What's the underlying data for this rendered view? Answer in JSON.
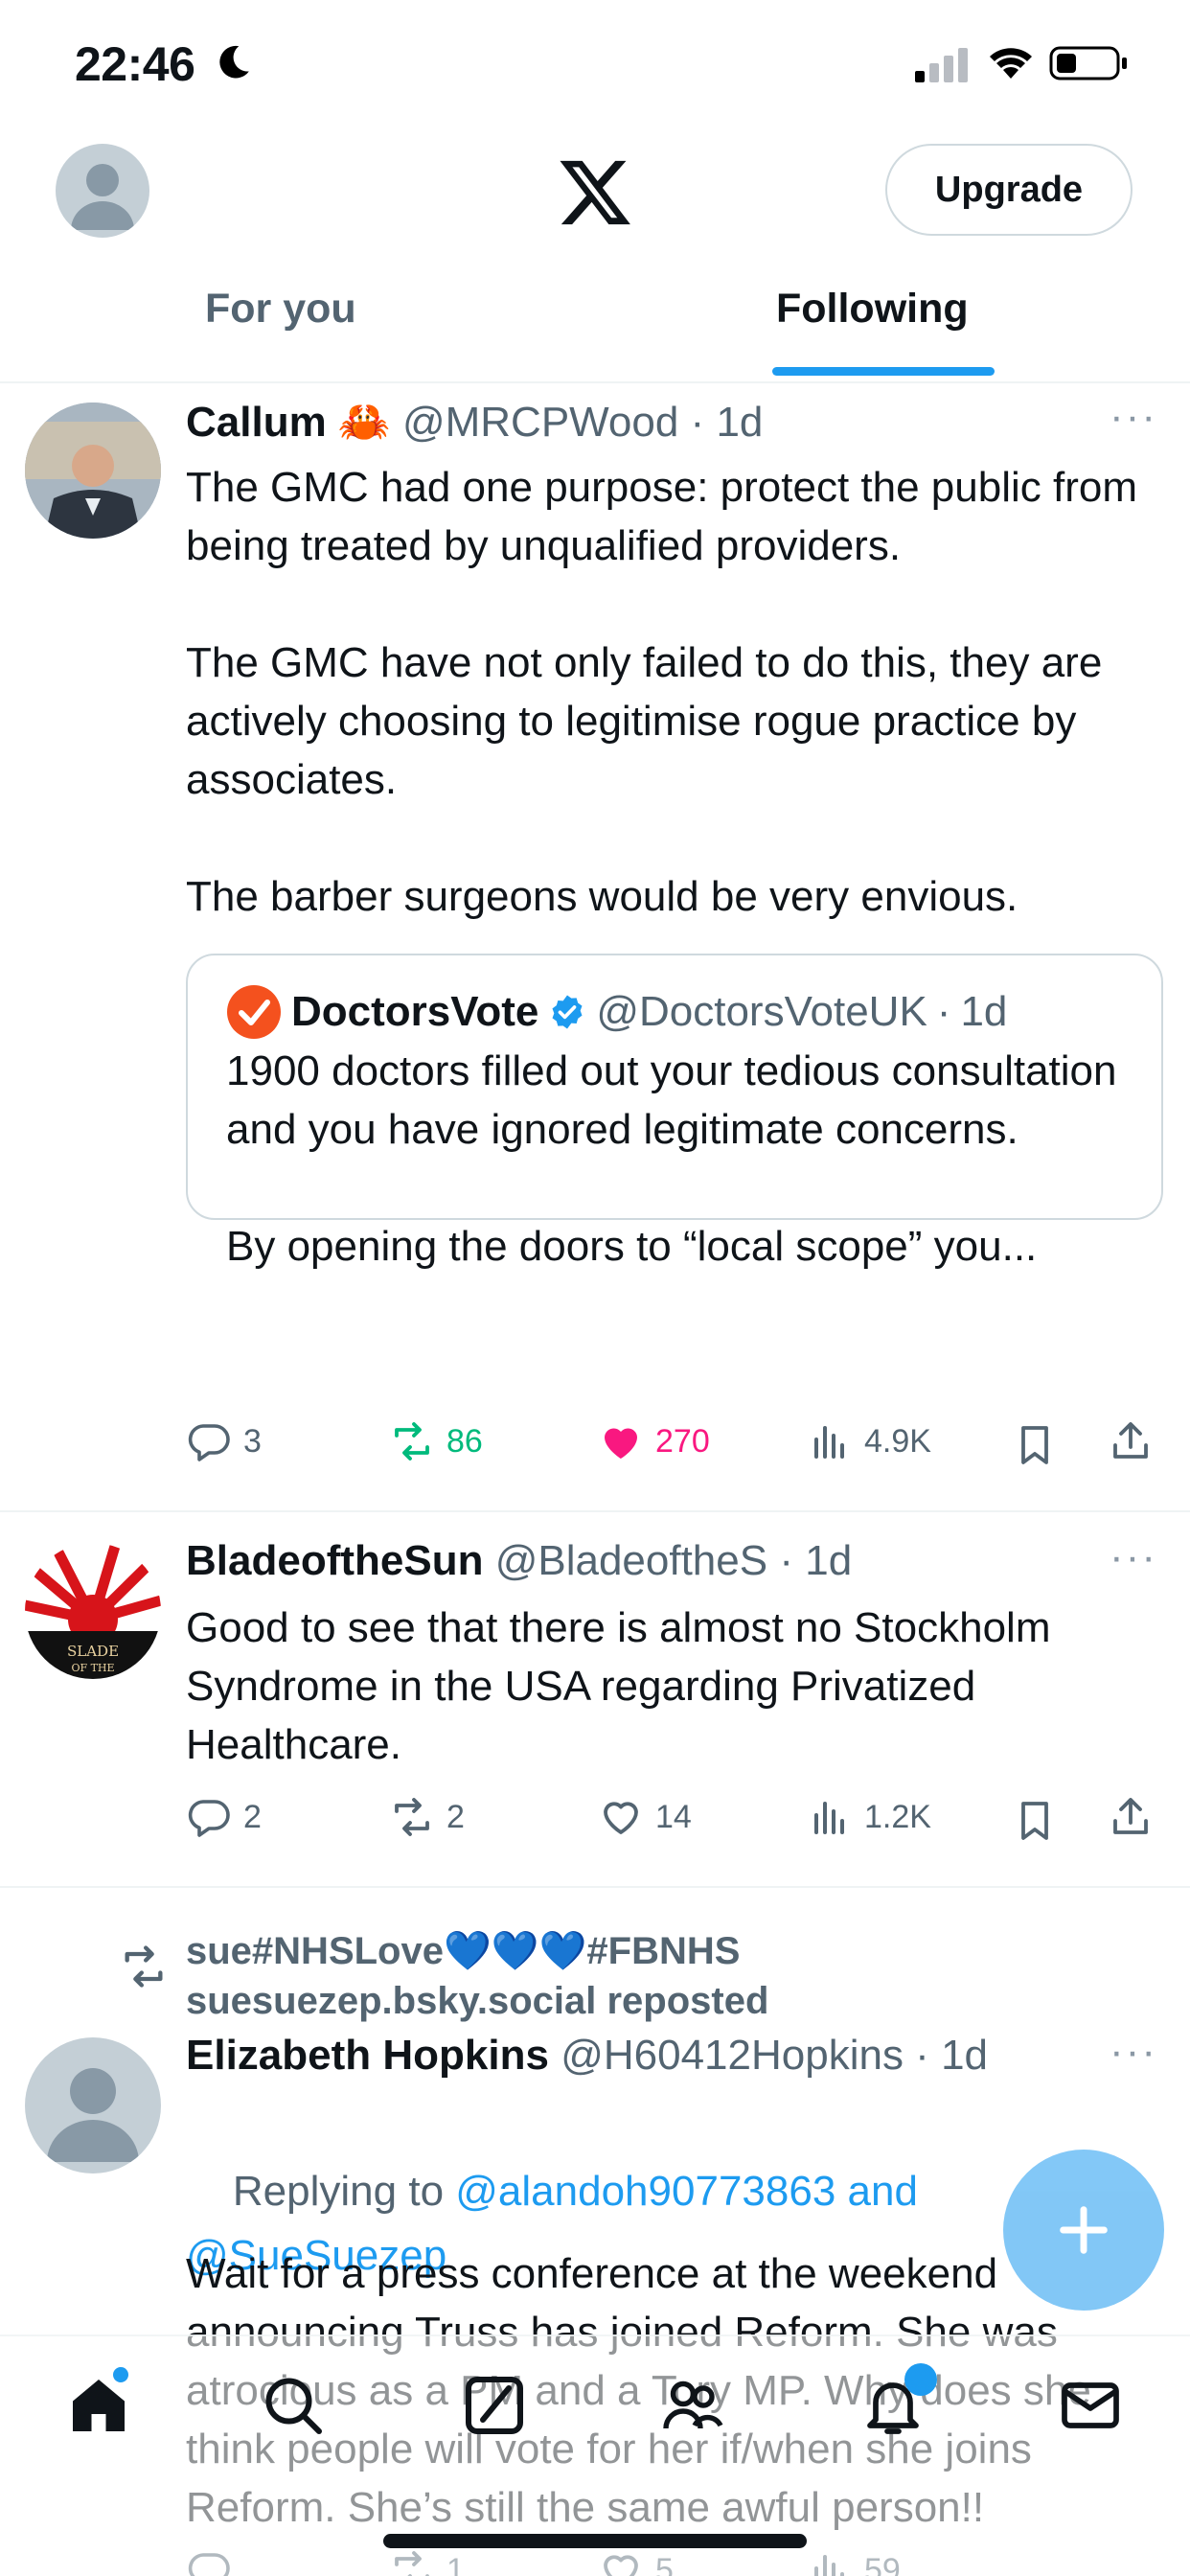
{
  "status_bar": {
    "time": "22:46"
  },
  "header": {
    "upgrade_label": "Upgrade",
    "tabs": [
      {
        "label": "For you",
        "selected": false
      },
      {
        "label": "Following",
        "selected": true
      }
    ]
  },
  "tweets": [
    {
      "name": "Callum 🦀",
      "handle": "@MRCPWood",
      "time": "1d",
      "text": "The GMC had one purpose: protect the public from being treated by unqualified providers.\n\nThe GMC have not only failed to do this, they are actively choosing to legitimise rogue practice by associates.\n\nThe barber surgeons would be very envious.",
      "quote": {
        "name": "DoctorsVote",
        "handle": "@DoctorsVoteUK",
        "time": "1d",
        "text": "1900 doctors filled out your tedious consultation and you have ignored legitimate concerns.\n\nBy opening the doors to “local scope” you..."
      },
      "replies": "3",
      "reposts": "86",
      "likes": "270",
      "views": "4.9K"
    },
    {
      "name": "BladeoftheSun",
      "handle": "@BladeoftheS",
      "time": "1d",
      "text": "Good to see that there is almost no Stockholm Syndrome in the USA regarding Privatized Healthcare.",
      "replies": "2",
      "reposts": "2",
      "likes": "14",
      "views": "1.2K"
    },
    {
      "repost_by": "sue#NHSLove💙💙💙#FBNHS",
      "repost_line2": "suesuezep.bsky.social reposted",
      "name": "Elizabeth Hopkins",
      "handle": "@H60412Hopkins",
      "time": "1d",
      "replying_prefix": "Replying to ",
      "replying_to": "@alandoh90773863 and @SueSuezep",
      "text": "Wait for a press conference at the weekend announcing Truss has joined Reform. She was atrocious as a PM and a Tory MP. Why does she think people will vote for her if/when she joins Reform. She’s still the same awful person!!",
      "replies": "",
      "reposts": "1",
      "likes": "5",
      "views": "59"
    }
  ],
  "colors": {
    "accent": "#1d9bf0",
    "like": "#f91880",
    "repost": "#00ba7c",
    "secondary_text": "#536471"
  }
}
